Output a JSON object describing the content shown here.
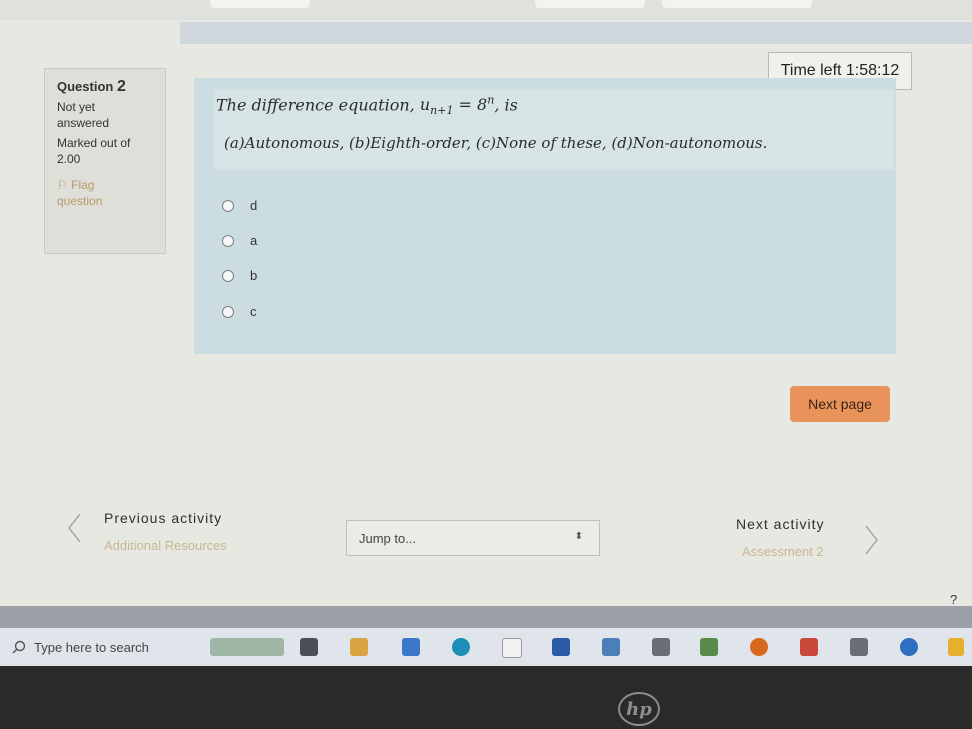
{
  "timer": {
    "label": "Time left",
    "value": "1:58:12"
  },
  "question_info": {
    "title_prefix": "Question",
    "number": "2",
    "status": [
      "Not yet",
      "answered"
    ],
    "marked_label": "Marked out of",
    "marked_value": "2.00",
    "flag_label": [
      "Flag",
      "question"
    ]
  },
  "question": {
    "prompt_start": "The difference equation, ",
    "prompt_end": ", is",
    "choices_text": "(a)Autonomous,   (b)Eighth-order,   (c)None of these,   (d)Non-autonomous."
  },
  "options": [
    "d",
    "a",
    "b",
    "c"
  ],
  "buttons": {
    "next_page": "Next page"
  },
  "navigation": {
    "previous_label": "Previous activity",
    "previous_link": "Additional Resources",
    "jump_placeholder": "Jump to...",
    "next_label": "Next activity",
    "next_link": "Assessment 2"
  },
  "help": "?",
  "taskbar": {
    "search_placeholder": "Type here to search"
  },
  "colors": {
    "next_button": "#e8935a",
    "link": "#c8b892",
    "question_bg": "#ccdde1"
  }
}
